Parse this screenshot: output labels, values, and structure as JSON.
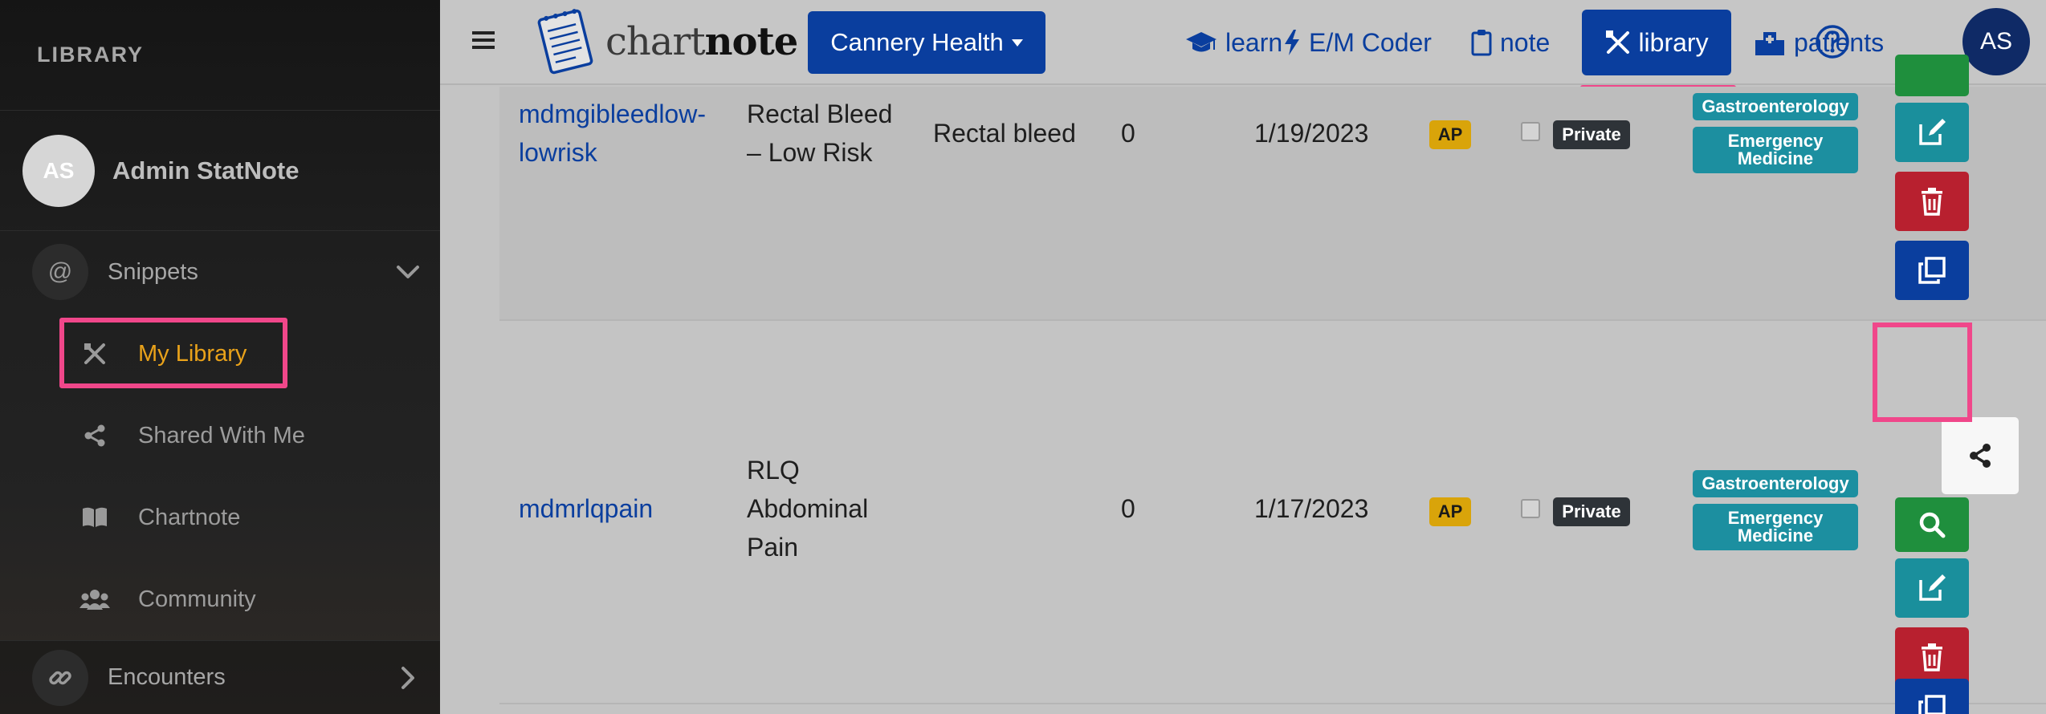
{
  "sidebar": {
    "header": "LIBRARY",
    "user": {
      "initials": "AS",
      "name": "Admin StatNote"
    },
    "group": {
      "label": "Snippets",
      "icon": "at-icon"
    },
    "items": [
      {
        "label": "My Library",
        "icon": "library-tools-icon",
        "active": true
      },
      {
        "label": "Shared With Me",
        "icon": "share-icon",
        "active": false
      },
      {
        "label": "Chartnote",
        "icon": "book-icon",
        "active": false
      },
      {
        "label": "Community",
        "icon": "users-icon",
        "active": false
      }
    ],
    "encounters": {
      "label": "Encounters",
      "icon": "link-icon"
    }
  },
  "navbar": {
    "logo": {
      "light": "chart",
      "bold": "note"
    },
    "org_button": "Cannery Health",
    "links": {
      "learn": "learn",
      "em_coder": "E/M Coder",
      "note": "note",
      "library": "library",
      "patients": "patients"
    },
    "avatar_initials": "AS"
  },
  "table": {
    "rows": [
      {
        "name": "mdmgibleedlow-lowrisk",
        "name_lines": [
          "mdmgibleedlow-",
          "lowrisk"
        ],
        "title_lines": [
          "Rectal Bleed",
          "– Low Risk"
        ],
        "description": "Rectal bleed",
        "count": "0",
        "date": "1/19/2023",
        "type_badge": "AP",
        "visibility": "Private",
        "tags": [
          "Gastroenterology",
          "Emergency Medicine"
        ]
      },
      {
        "name": "mdmrlqpain",
        "title_lines": [
          "RLQ",
          "Abdominal",
          "Pain"
        ],
        "description": "",
        "count": "0",
        "date": "1/17/2023",
        "type_badge": "AP",
        "visibility": "Private",
        "tags": [
          "Gastroenterology",
          "Emergency Medicine"
        ]
      }
    ]
  },
  "colors": {
    "primary": "#0a3e9e",
    "highlight": "#f0478a",
    "active_menu": "#e9a21a",
    "tag": "#1c8fa0",
    "badge_ap": "#d9a40a"
  }
}
